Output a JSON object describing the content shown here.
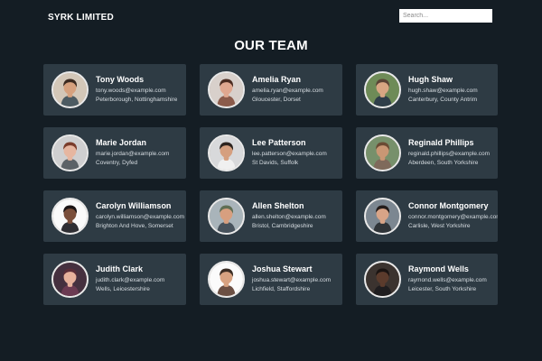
{
  "header": {
    "brand": "SYRK LIMITED",
    "search_placeholder": "Search..."
  },
  "section_title": "OUR TEAM",
  "team": [
    {
      "name": "Tony Woods",
      "email": "tony.woods@example.com",
      "location": "Peterborough, Nottinghamshire",
      "bg": "#d3c7b8",
      "skin": "#d6a17e",
      "hair": "#3b2a20",
      "shirt": "#4d5b62"
    },
    {
      "name": "Amelia Ryan",
      "email": "amelia.ryan@example.com",
      "location": "Gloucester, Dorset",
      "bg": "#d8d0cb",
      "skin": "#e0a78f",
      "hair": "#4c2c21",
      "shirt": "#8b5b4b"
    },
    {
      "name": "Hugh Shaw",
      "email": "hugh.shaw@example.com",
      "location": "Canterbury, County Antrim",
      "bg": "#6e8b57",
      "skin": "#d8a683",
      "hair": "#5a4436",
      "shirt": "#2f3e49"
    },
    {
      "name": "Marie Jordan",
      "email": "marie.jordan@example.com",
      "location": "Coventry, Dyfed",
      "bg": "#cfcfd0",
      "skin": "#e6b6a0",
      "hair": "#7a3c2b",
      "shirt": "#5c6267"
    },
    {
      "name": "Lee Patterson",
      "email": "lee.patterson@example.com",
      "location": "St Davids, Suffolk",
      "bg": "#d8d9db",
      "skin": "#d59f7f",
      "hair": "#2d241f",
      "shirt": "#f0f0f0"
    },
    {
      "name": "Reginald Phillips",
      "email": "reginald.phillips@example.com",
      "location": "Aberdeen, South Yorkshire",
      "bg": "#77906b",
      "skin": "#c99774",
      "hair": "#6a4b34",
      "shirt": "#7f6a5b"
    },
    {
      "name": "Carolyn Williamson",
      "email": "carolyn.williamson@example.com",
      "location": "Brighton And Hove, Somerset",
      "bg": "#fafafa",
      "skin": "#7a4e3a",
      "hair": "#1b1414",
      "shirt": "#2e2e33"
    },
    {
      "name": "Allen Shelton",
      "email": "allen.shelton@example.com",
      "location": "Bristol, Cambridgeshire",
      "bg": "#a9b4ba",
      "skin": "#d79f7f",
      "hair": "#5f6e54",
      "shirt": "#47525c"
    },
    {
      "name": "Connor Montgomery",
      "email": "connor.montgomery@example.com",
      "location": "Carlisle, West Yorkshire",
      "bg": "#7c8791",
      "skin": "#d8a487",
      "hair": "#241d1b",
      "shirt": "#2f3438"
    },
    {
      "name": "Judith Clark",
      "email": "judith.clark@example.com",
      "location": "Wells, Leicestershire",
      "bg": "#45303f",
      "skin": "#e7b19c",
      "hair": "#5a2d39",
      "shirt": "#6b3a52"
    },
    {
      "name": "Joshua Stewart",
      "email": "joshua.stewart@example.com",
      "location": "Lichfield, Staffordshire",
      "bg": "#fbfbfb",
      "skin": "#d7a281",
      "hair": "#3b2d24",
      "shirt": "#6b5044"
    },
    {
      "name": "Raymond Wells",
      "email": "raymond.wells@example.com",
      "location": "Leicester, South Yorkshire",
      "bg": "#3b332f",
      "skin": "#5b3b2c",
      "hair": "#1b1412",
      "shirt": "#1f1d1f"
    }
  ]
}
